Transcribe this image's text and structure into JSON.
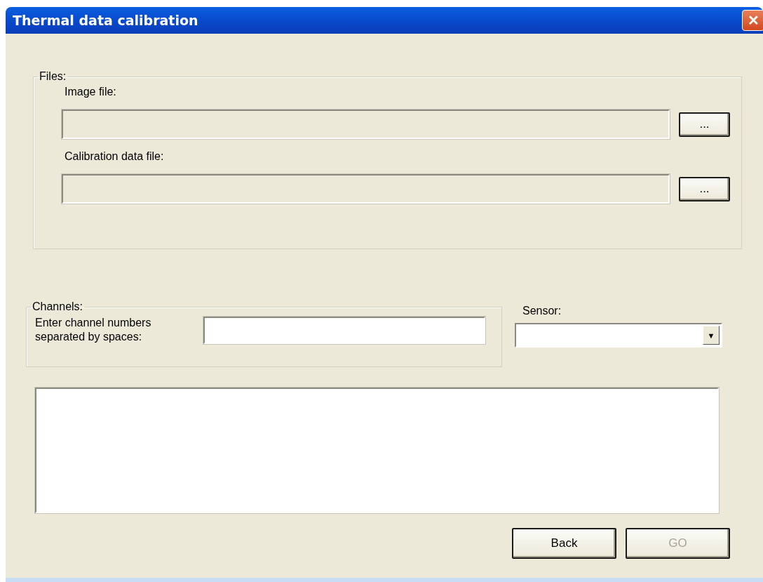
{
  "window": {
    "title": "Thermal data calibration",
    "close": "✕"
  },
  "files": {
    "legend": "Files:",
    "fields": [
      {
        "label": "Image file:",
        "disabled": true,
        "browse": "..."
      },
      {
        "label": "Calibration data file:",
        "disabled": true,
        "browse": "..."
      }
    ]
  },
  "channels": {
    "legend": "Channels:",
    "label": "Enter channel numbers separated by spaces:"
  },
  "sensor": {
    "label": "Sensor:",
    "arrow": "▼"
  },
  "buttons": [
    {
      "label": "Back",
      "disabled": false
    },
    {
      "label": "GO",
      "disabled": true
    }
  ]
}
